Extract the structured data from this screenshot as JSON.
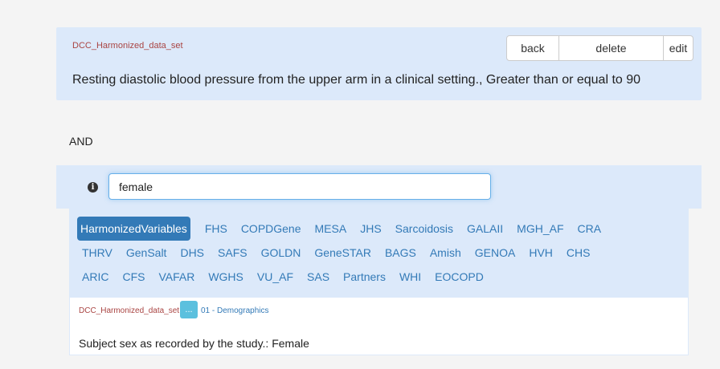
{
  "criterion": {
    "source": "DCC_Harmonized_data_set",
    "description": "Resting diastolic blood pressure from the upper arm in a clinical setting., Greater than or equal to 90",
    "buttons": {
      "back": "back",
      "delete": "delete",
      "edit": "edit"
    }
  },
  "operator": "AND",
  "search": {
    "value": "female",
    "info_icon": "info-icon"
  },
  "tabs": {
    "row1": [
      "HarmonizedVariables",
      "FHS",
      "COPDGene",
      "MESA",
      "JHS",
      "Sarcoidosis",
      "GALAII",
      "MGH_AF",
      "CRA"
    ],
    "row2": [
      "THRV",
      "GenSalt",
      "DHS",
      "SAFS",
      "GOLDN",
      "GeneSTAR",
      "BAGS",
      "Amish",
      "GENOA",
      "HVH",
      "CHS"
    ],
    "row3": [
      "ARIC",
      "CFS",
      "VAFAR",
      "WGHS",
      "VU_AF",
      "SAS",
      "Partners",
      "WHI",
      "EOCOPD"
    ],
    "active": "HarmonizedVariables"
  },
  "result": {
    "source": "DCC_Harmonized_data_set",
    "ellipsis": "...",
    "category": "01 - Demographics",
    "text": "Subject sex as recorded by the study.: Female"
  },
  "colors": {
    "accent": "#337ab7",
    "panel": "#dce9fa",
    "source_text": "#a94442",
    "info_button": "#5bc0de"
  }
}
